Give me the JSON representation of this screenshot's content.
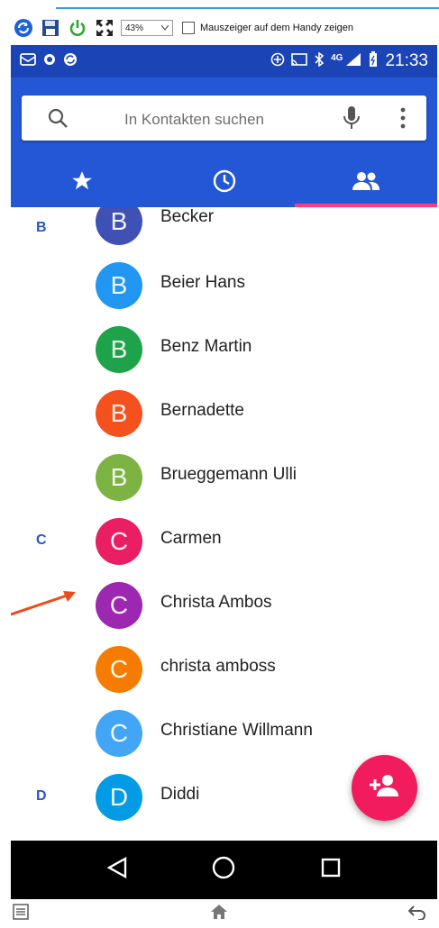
{
  "host": {
    "zoom_value": "43%",
    "checkbox_label": "Mauszeiger auf dem Handy zeigen"
  },
  "statusbar": {
    "network": "4G",
    "time": "21:33"
  },
  "search": {
    "placeholder": "In Kontakten suchen"
  },
  "tabs": [
    {
      "label": "favorites",
      "icon": "star-icon",
      "active": false
    },
    {
      "label": "recent",
      "icon": "clock-icon",
      "active": false
    },
    {
      "label": "contacts",
      "icon": "people-icon",
      "active": true
    }
  ],
  "contacts": [
    {
      "section": "B",
      "initial": "B",
      "name": "Becker",
      "color": "#3f51b5"
    },
    {
      "section": "",
      "initial": "B",
      "name": "Beier Hans",
      "color": "#2196f3"
    },
    {
      "section": "",
      "initial": "B",
      "name": "Benz Martin",
      "color": "#1fa34a"
    },
    {
      "section": "",
      "initial": "B",
      "name": "Bernadette",
      "color": "#f4511e"
    },
    {
      "section": "",
      "initial": "B",
      "name": "Brueggemann Ulli",
      "color": "#7cb342"
    },
    {
      "section": "C",
      "initial": "C",
      "name": "Carmen",
      "color": "#e91e63"
    },
    {
      "section": "",
      "initial": "C",
      "name": "Christa Ambos",
      "color": "#9c27b0"
    },
    {
      "section": "",
      "initial": "C",
      "name": "christa amboss",
      "color": "#f57c00"
    },
    {
      "section": "",
      "initial": "C",
      "name": "Christiane Willmann",
      "color": "#42a5f5"
    },
    {
      "section": "D",
      "initial": "D",
      "name": "Diddi",
      "color": "#039be5"
    },
    {
      "section": "",
      "initial": "",
      "name": "",
      "color": "#f57c00"
    }
  ],
  "colors": {
    "statusbar": "#1b44b6",
    "appbar": "#2457d6",
    "tab_indicator": "#ff3d7f",
    "fab": "#f21b5d",
    "section_letter": "#2b55c9",
    "annotation_arrow": "#f04a1a"
  }
}
